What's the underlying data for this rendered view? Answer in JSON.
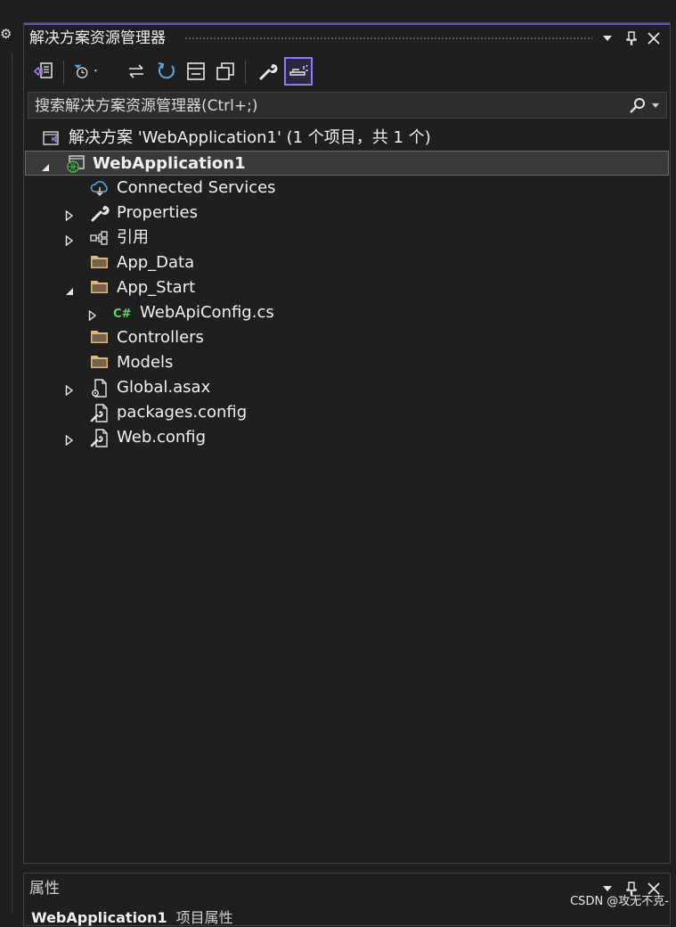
{
  "left_strip": {
    "icon": "gear-icon"
  },
  "solution_explorer": {
    "title": "解决方案资源管理器",
    "window_buttons": [
      "dropdown-icon",
      "pin-icon",
      "close-icon"
    ],
    "toolbar": [
      "switch-views-icon",
      "pending-changes-filter-icon",
      "sync-active-document-icon",
      "refresh-icon",
      "collapse-all-icon",
      "show-all-files-icon",
      "properties-icon",
      "preview-selected-items-icon"
    ],
    "search_placeholder": "搜索解决方案资源管理器(Ctrl+;)",
    "tree": [
      {
        "label": "解决方案 'WebApplication1' (1 个项目，共 1 个)",
        "icon": "solution-icon",
        "expander": "none"
      },
      {
        "label": "WebApplication1",
        "icon": "web-project-icon",
        "expander": "expanded",
        "bold": true,
        "selected": true
      },
      {
        "label": "Connected Services",
        "icon": "connected-services-icon",
        "expander": "none"
      },
      {
        "label": "Properties",
        "icon": "wrench-icon",
        "expander": "collapsed"
      },
      {
        "label": "引用",
        "icon": "references-icon",
        "expander": "collapsed"
      },
      {
        "label": "App_Data",
        "icon": "folder-icon",
        "expander": "none"
      },
      {
        "label": "App_Start",
        "icon": "folder-icon",
        "expander": "expanded"
      },
      {
        "label": "WebApiConfig.cs",
        "icon": "csharp-file-icon",
        "expander": "collapsed"
      },
      {
        "label": "Controllers",
        "icon": "folder-icon",
        "expander": "none"
      },
      {
        "label": "Models",
        "icon": "folder-icon",
        "expander": "none"
      },
      {
        "label": "Global.asax",
        "icon": "gear-file-icon",
        "expander": "collapsed"
      },
      {
        "label": "packages.config",
        "icon": "config-file-icon",
        "expander": "none"
      },
      {
        "label": "Web.config",
        "icon": "config-file-icon",
        "expander": "collapsed"
      }
    ]
  },
  "properties_panel": {
    "title": "属性",
    "subtitle_bold": "WebApplication1",
    "subtitle_rest": "项目属性"
  },
  "watermark": "CSDN @攻无不克-",
  "colors": {
    "accent": "#6b52c2",
    "background": "#1f1f1f",
    "selection": "#3a3a3a",
    "folder": "#dcb67a",
    "csharp": "#68d06a"
  }
}
